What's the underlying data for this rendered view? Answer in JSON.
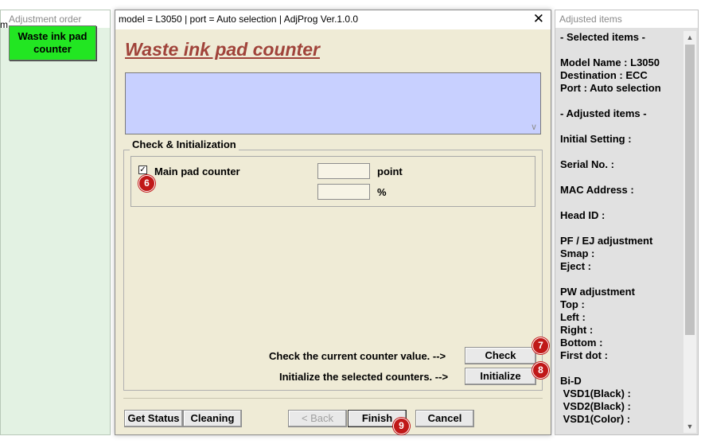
{
  "left_panel": {
    "title": "Adjustment order",
    "stub_char": "m",
    "active_item": "Waste ink pad counter"
  },
  "dialog": {
    "window_title": "model = L3050 | port = Auto selection | AdjProg Ver.1.0.0",
    "close_glyph": "✕",
    "page_title": "Waste ink pad counter",
    "group_title": "Check & Initialization",
    "main_pad": {
      "label": "Main pad counter",
      "checked": true,
      "check_glyph": "✓",
      "point_value": "",
      "percent_value": "",
      "unit_point": "point",
      "unit_percent": "%"
    },
    "check_text": "Check the current counter value. -->",
    "init_text": "Initialize the selected counters. -->",
    "buttons": {
      "check": "Check",
      "initialize": "Initialize",
      "get_status": "Get Status",
      "cleaning": "Cleaning",
      "back": "< Back",
      "finish": "Finish",
      "cancel": "Cancel"
    }
  },
  "badges": {
    "main_pad": "6",
    "check": "7",
    "initialize": "8",
    "finish": "9"
  },
  "right_panel": {
    "title": "Adjusted items",
    "content": "- Selected items -\n\nModel Name : L3050\nDestination : ECC\nPort : Auto selection\n\n- Adjusted items -\n\nInitial Setting :\n\nSerial No. :\n\nMAC Address :\n\nHead ID :\n\nPF / EJ adjustment\nSmap :\nEject :\n\nPW adjustment\nTop :\nLeft :\nRight :\nBottom :\nFirst dot :\n\nBi-D\n VSD1(Black) :\n VSD2(Black) :\n VSD1(Color) :"
  },
  "colors": {
    "title_red": "#a0433a",
    "info_blue": "#c8d0ff",
    "dialog_bg": "#efebd6",
    "green_button": "#22e622",
    "badge_red": "#c01818"
  }
}
